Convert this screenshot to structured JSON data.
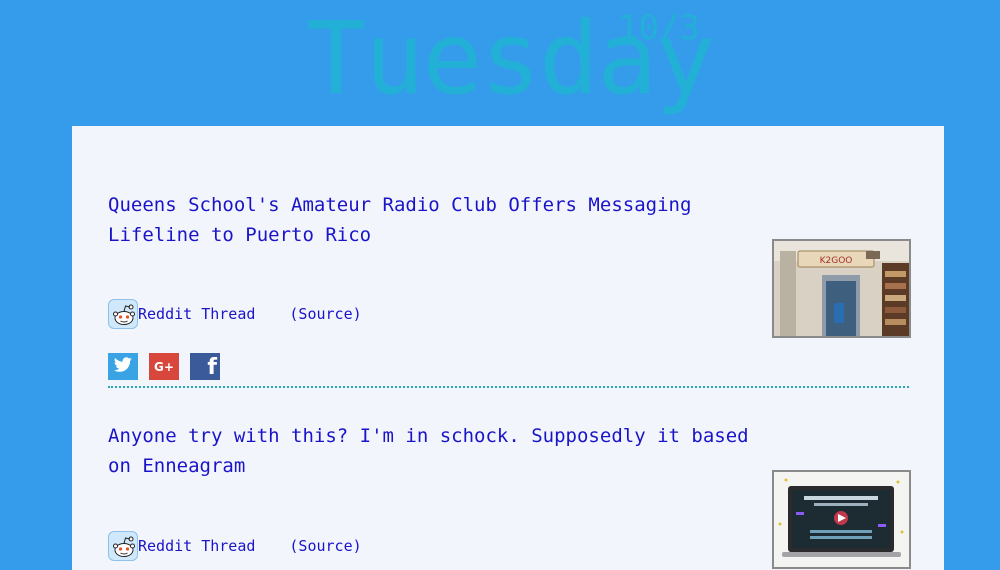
{
  "header": {
    "day": "Tuesday",
    "date": "10/3"
  },
  "posts": [
    {
      "title": "Queens School's Amateur Radio Club Offers Messaging Lifeline to Puerto Rico",
      "reddit_label": "Reddit Thread",
      "source_label": "(Source)",
      "thumb_sign": "K2GOO"
    },
    {
      "title": "Anyone try with this? I'm in schock. Supposedly it based on Enneagram",
      "reddit_label": "Reddit Thread",
      "source_label": "(Source)"
    }
  ],
  "share_buttons": [
    {
      "icon": "twitter-icon",
      "color": "#3aa3e3"
    },
    {
      "icon": "google-plus-icon",
      "label": "G+",
      "color": "#d7473b"
    },
    {
      "icon": "facebook-icon",
      "label": "f",
      "color": "#3b5a9a"
    }
  ],
  "colors": {
    "background": "#349cea",
    "card": "#f3f5fc",
    "link": "#1a14c9",
    "masthead_text": "#23b0d6"
  }
}
